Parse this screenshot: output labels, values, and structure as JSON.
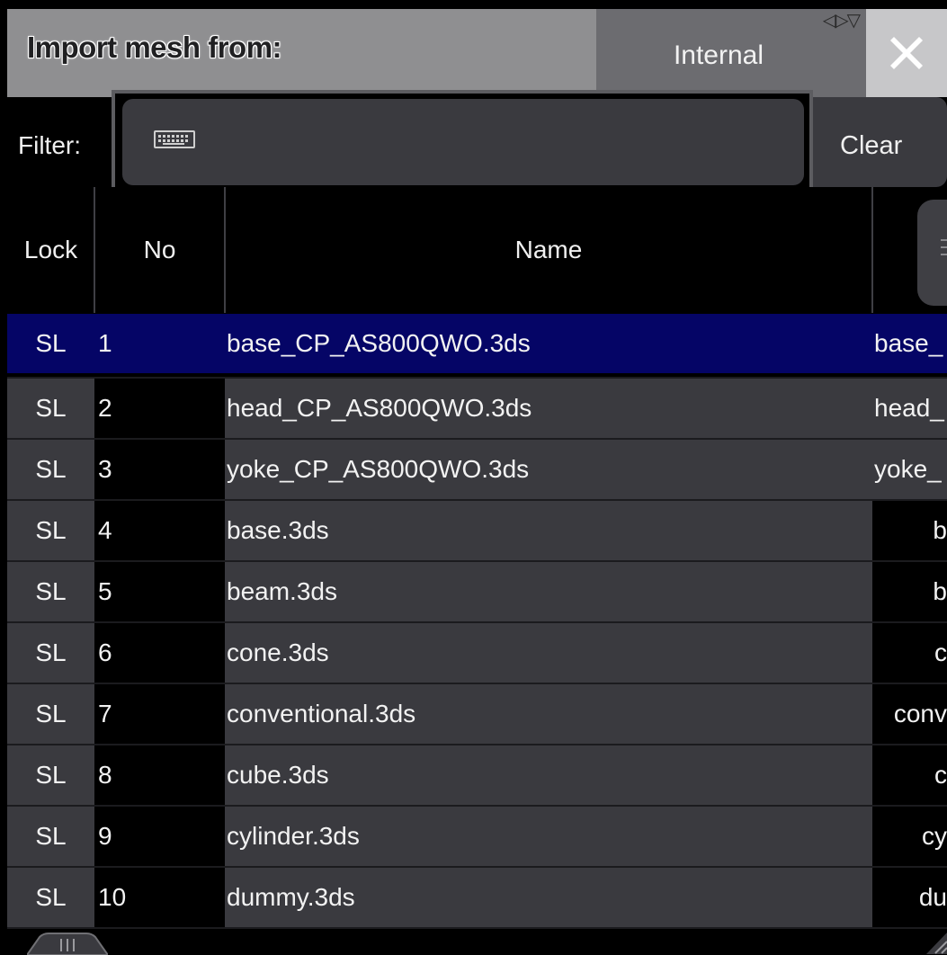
{
  "title": "Import mesh from:",
  "source": {
    "label": "Internal",
    "arrows": "◁▷▽"
  },
  "filter": {
    "label": "Filter:",
    "value": "",
    "clear_label": "Clear"
  },
  "columns": {
    "lock": "Lock",
    "no": "No",
    "name": "Name"
  },
  "rows": [
    {
      "lock": "SL",
      "no": "1",
      "name": "base_CP_AS800QWO.3ds",
      "file": "base_",
      "selected": true
    },
    {
      "lock": "SL",
      "no": "2",
      "name": "head_CP_AS800QWO.3ds",
      "file": "head_"
    },
    {
      "lock": "SL",
      "no": "3",
      "name": "yoke_CP_AS800QWO.3ds",
      "file": "yoke_"
    },
    {
      "lock": "SL",
      "no": "4",
      "name": "base.3ds",
      "file": "b"
    },
    {
      "lock": "SL",
      "no": "5",
      "name": "beam.3ds",
      "file": "b"
    },
    {
      "lock": "SL",
      "no": "6",
      "name": "cone.3ds",
      "file": "c"
    },
    {
      "lock": "SL",
      "no": "7",
      "name": "conventional.3ds",
      "file": "conv"
    },
    {
      "lock": "SL",
      "no": "8",
      "name": "cube.3ds",
      "file": "c"
    },
    {
      "lock": "SL",
      "no": "9",
      "name": "cylinder.3ds",
      "file": "cy"
    },
    {
      "lock": "SL",
      "no": "10",
      "name": "dummy.3ds",
      "file": "du"
    }
  ],
  "colors": {
    "selected_row": "#050566",
    "cell_bg": "#3a3a3f",
    "titlebar": "#8f8f91"
  }
}
